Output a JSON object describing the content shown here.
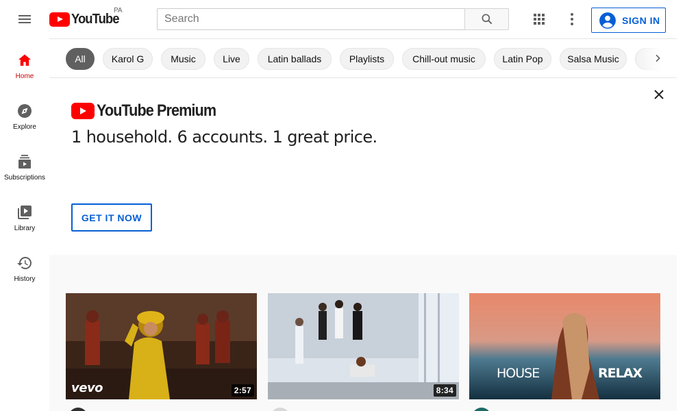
{
  "header": {
    "logo_text": "YouTube",
    "country_code": "PA",
    "search_placeholder": "Search",
    "signin_label": "SIGN IN"
  },
  "guide": {
    "items": [
      {
        "label": "Home",
        "icon": "home-icon",
        "active": true
      },
      {
        "label": "Explore",
        "icon": "compass-icon",
        "active": false
      },
      {
        "label": "Subscriptions",
        "icon": "subscriptions-icon",
        "active": false
      },
      {
        "label": "Library",
        "icon": "library-icon",
        "active": false
      },
      {
        "label": "History",
        "icon": "history-icon",
        "active": false
      }
    ]
  },
  "chips": {
    "items": [
      "All",
      "Karol G",
      "Music",
      "Live",
      "Latin ballads",
      "Playlists",
      "Chill-out music",
      "Latin Pop",
      "Salsa Music"
    ]
  },
  "banner": {
    "logo_text": "YouTube Premium",
    "tagline": "1 household. 6 accounts. 1 great price.",
    "cta_label": "GET IT NOW"
  },
  "videos": [
    {
      "duration": "2:57",
      "overlay": "vevo"
    },
    {
      "duration": "8:34"
    },
    {
      "overlay_left": "HOUSE",
      "overlay_right": "RELAX"
    }
  ],
  "colors": {
    "brand_red": "#ff0000",
    "accent_blue": "#065fd4",
    "active_red": "#cc0000"
  }
}
